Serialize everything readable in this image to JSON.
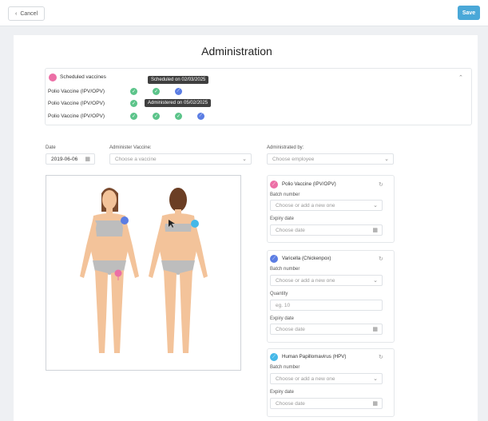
{
  "toolbar": {
    "cancel_label": "Cancel",
    "save_label": "Save"
  },
  "page": {
    "title": "Administration"
  },
  "scheduled": {
    "title": "Scheduled vaccines",
    "rows": [
      {
        "name": "Polio Vaccine (IPV/OPV)"
      },
      {
        "name": "Polio Vaccine (IPV/OPV)"
      },
      {
        "name": "Polio Vaccine (IPV/OPV)"
      }
    ],
    "tooltip_scheduled": "Scheduled on 02/03/2025",
    "tooltip_administered": "Administered on 05/02/2025"
  },
  "form": {
    "date_label": "Date",
    "date_value": "2019-06-06",
    "vaccine_label": "Administer Vaccine:",
    "vaccine_placeholder": "Choose a vaccine",
    "admin_by_label": "Administrated by:",
    "admin_by_placeholder": "Choose employee"
  },
  "cards": [
    {
      "title": "Polio Vaccine (IPV/OPV)",
      "color": "#ec6fa6",
      "batch_label": "Batch number",
      "batch_placeholder": "Choose or add a new one",
      "expiry_label": "Expiry date",
      "expiry_placeholder": "Choose date"
    },
    {
      "title": "Varicella (Chickenpox)",
      "color": "#5b7de3",
      "batch_label": "Batch number",
      "batch_placeholder": "Choose or add a new one",
      "quantity_label": "Quantity",
      "quantity_placeholder": "eg. 10",
      "expiry_label": "Expiry date",
      "expiry_placeholder": "Choose date"
    },
    {
      "title": "Human Papillomavirus (HPV)",
      "color": "#45b8e8",
      "batch_label": "Batch number",
      "batch_placeholder": "Choose or add a new one",
      "expiry_label": "Expiry date",
      "expiry_placeholder": "Choose date"
    }
  ],
  "colors": {
    "accent": "#4aa8d8",
    "check_green": "#5cc48a",
    "scheduled_blue": "#5b7de3",
    "pink": "#ec6fa6",
    "cyan": "#45b8e8"
  }
}
